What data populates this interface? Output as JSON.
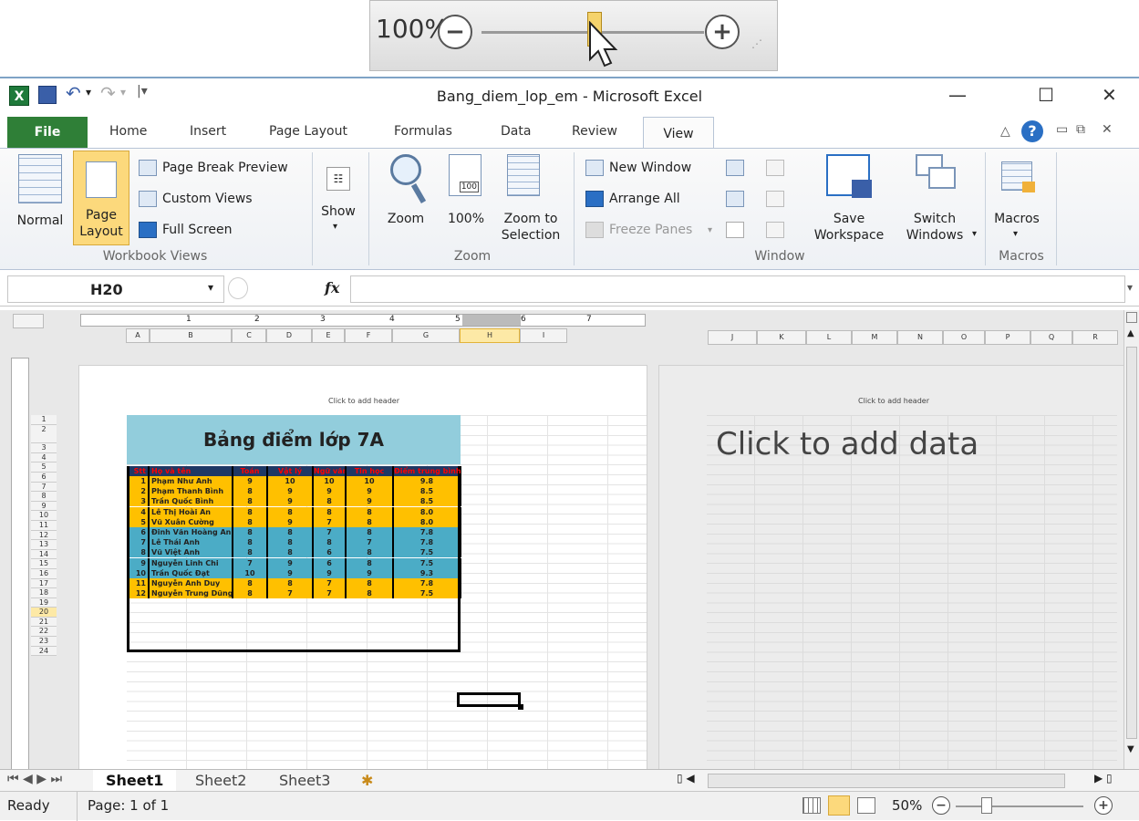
{
  "zoom_inset": {
    "percent": "100%",
    "level": 0.5
  },
  "window": {
    "title": "Bang_diem_lop_em - Microsoft Excel"
  },
  "tabs": [
    {
      "label": "File"
    },
    {
      "label": "Home"
    },
    {
      "label": "Insert"
    },
    {
      "label": "Page Layout"
    },
    {
      "label": "Formulas"
    },
    {
      "label": "Data"
    },
    {
      "label": "Review"
    },
    {
      "label": "View"
    }
  ],
  "ribbon": {
    "workbook_views": {
      "normal": "Normal",
      "page_layout_1": "Page",
      "page_layout_2": "Layout",
      "page_break_preview": "Page Break Preview",
      "custom_views": "Custom Views",
      "full_screen": "Full Screen",
      "group_label": "Workbook Views"
    },
    "show": {
      "label": "Show"
    },
    "zoom": {
      "zoom": "Zoom",
      "hundred": "100%",
      "zoom_to_1": "Zoom to",
      "zoom_to_2": "Selection",
      "group_label": "Zoom",
      "icon_text": "100"
    },
    "window": {
      "new_window": "New Window",
      "arrange_all": "Arrange All",
      "freeze_panes": "Freeze Panes",
      "save_1": "Save",
      "save_2": "Workspace",
      "switch_1": "Switch",
      "switch_2": "Windows",
      "group_label": "Window"
    },
    "macros": {
      "label": "Macros",
      "group_label": "Macros"
    }
  },
  "formula_bar": {
    "name_box": "H20",
    "fx": "fx",
    "value": ""
  },
  "ruler": {
    "marks": [
      "1",
      "2",
      "3",
      "4",
      "5",
      "6",
      "7"
    ]
  },
  "columns_left": [
    "A",
    "B",
    "C",
    "D",
    "E",
    "F",
    "G",
    "H",
    "I"
  ],
  "columns_right": [
    "J",
    "K",
    "L",
    "M",
    "N",
    "O",
    "P",
    "Q",
    "R"
  ],
  "rows": [
    "1",
    "2",
    "3",
    "4",
    "5",
    "6",
    "7",
    "8",
    "9",
    "10",
    "11",
    "12",
    "13",
    "14",
    "15",
    "16",
    "17",
    "18",
    "19",
    "20",
    "21",
    "22",
    "23",
    "24"
  ],
  "page1": {
    "header": "Click to add header"
  },
  "page2": {
    "header": "Click to add header",
    "placeholder": "Click to add data"
  },
  "sheet": {
    "title": "Bảng điểm lớp 7A",
    "headers": [
      "Stt",
      "Họ và tên",
      "Toán",
      "Vật lý",
      "Ngữ văn",
      "Tin học",
      "Điểm trung bình"
    ],
    "rows": [
      [
        "1",
        "Phạm Như Anh",
        "9",
        "10",
        "10",
        "10",
        "9.8"
      ],
      [
        "2",
        "Phạm Thanh Bình",
        "8",
        "9",
        "9",
        "9",
        "8.5"
      ],
      [
        "3",
        "Trần Quốc Bình",
        "8",
        "9",
        "8",
        "9",
        "8.5"
      ],
      [
        "4",
        "Lê Thị Hoài An",
        "8",
        "8",
        "8",
        "8",
        "8.0"
      ],
      [
        "5",
        "Vũ Xuân Cường",
        "8",
        "9",
        "7",
        "8",
        "8.0"
      ],
      [
        "6",
        "Đinh Văn Hoàng An",
        "8",
        "8",
        "7",
        "8",
        "7.8"
      ],
      [
        "7",
        "Lê Thái Anh",
        "8",
        "8",
        "8",
        "7",
        "7.8"
      ],
      [
        "8",
        "Vũ Việt Anh",
        "8",
        "8",
        "6",
        "8",
        "7.5"
      ],
      [
        "9",
        "Nguyễn Linh Chi",
        "7",
        "9",
        "6",
        "8",
        "7.5"
      ],
      [
        "10",
        "Trần Quốc Đạt",
        "10",
        "9",
        "9",
        "9",
        "9.3"
      ],
      [
        "11",
        "Nguyễn Anh Duy",
        "8",
        "8",
        "7",
        "8",
        "7.8"
      ],
      [
        "12",
        "Nguyễn Trung Dũng",
        "8",
        "7",
        "7",
        "8",
        "7.5"
      ]
    ]
  },
  "sheet_tabs": [
    "Sheet1",
    "Sheet2",
    "Sheet3"
  ],
  "status": {
    "ready": "Ready",
    "page": "Page: 1 of 1",
    "zoom": "50%"
  },
  "colors": {
    "title_bg": "#92cddc",
    "row_orange": "#ffc000",
    "row_teal": "#4bacc6",
    "header_row": "#1f3864",
    "header_text": "#ff0000",
    "file_tab": "#2f7f37"
  }
}
